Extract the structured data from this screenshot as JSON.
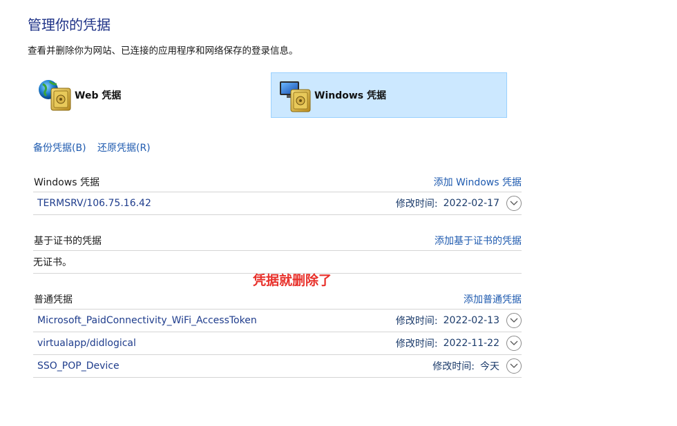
{
  "header": {
    "title": "管理你的凭据",
    "description": "查看并删除你为网站、已连接的应用程序和网络保存的登录信息。"
  },
  "credential_types": {
    "web": {
      "label": "Web 凭据",
      "icon": "web-credentials-icon"
    },
    "windows": {
      "label": "Windows 凭据",
      "icon": "windows-credentials-icon",
      "selected": true
    }
  },
  "actions": {
    "backup": "备份凭据(B)",
    "restore": "还原凭据(R)"
  },
  "sections": {
    "windows": {
      "title": "Windows 凭据",
      "add_link": "添加 Windows 凭据",
      "items": [
        {
          "name": "TERMSRV/106.75.16.42",
          "date_label": "修改时间:",
          "date": "2022-02-17"
        }
      ]
    },
    "certificate": {
      "title": "基于证书的凭据",
      "add_link": "添加基于证书的凭据",
      "empty_text": "无证书。"
    },
    "generic": {
      "title": "普通凭据",
      "add_link": "添加普通凭据",
      "items": [
        {
          "name": "Microsoft_PaidConnectivity_WiFi_AccessToken",
          "date_label": "修改时间:",
          "date": "2022-02-13"
        },
        {
          "name": "virtualapp/didlogical",
          "date_label": "修改时间:",
          "date": "2022-11-22"
        },
        {
          "name": "SSO_POP_Device",
          "date_label": "修改时间:",
          "date": "今天"
        }
      ]
    }
  },
  "annotation": {
    "text": "凭据就删除了",
    "color": "#e8302a"
  },
  "colors": {
    "accent": "#1e5aaf",
    "title": "#1e3287",
    "selected_bg": "#cce8ff",
    "selected_border": "#99d1ff"
  }
}
